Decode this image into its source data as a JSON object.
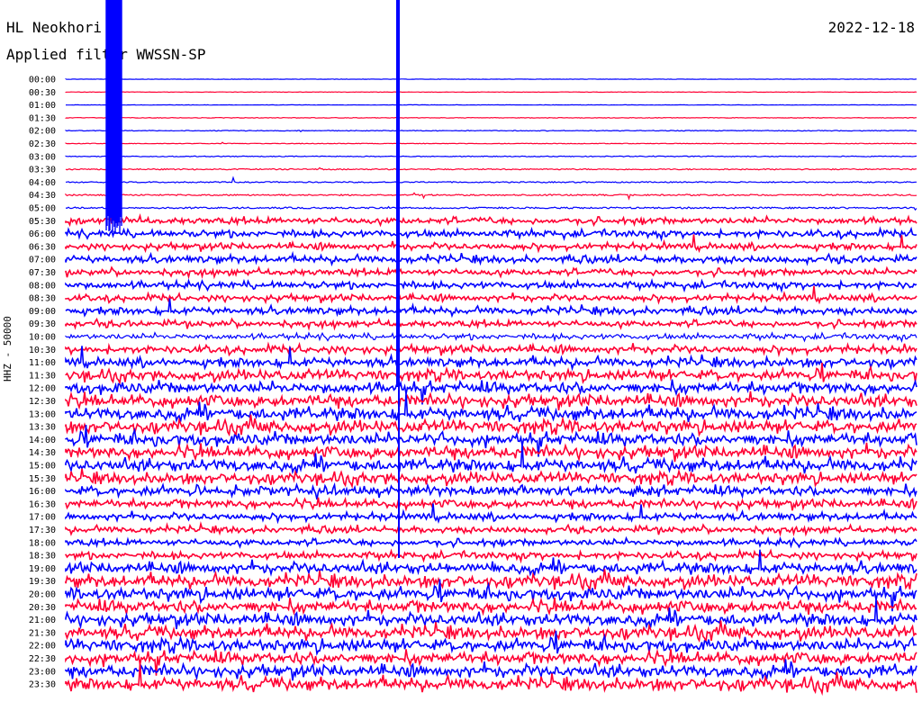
{
  "header": {
    "station": "HL Neokhori",
    "filter": "Applied filter WWSSN-SP",
    "date": "2022-12-18"
  },
  "chart_data": {
    "type": "line",
    "title": "HL Neokhori",
    "subtitle": "Applied filter WWSSN-SP",
    "date": "2022-12-18",
    "ylabel": "HHZ - 50000",
    "xlabel": "",
    "tick_labels": [
      "00:00",
      "00:30",
      "01:00",
      "01:30",
      "02:00",
      "02:30",
      "03:00",
      "03:30",
      "04:00",
      "04:30",
      "05:00",
      "05:30",
      "06:00",
      "06:30",
      "07:00",
      "07:30",
      "08:00",
      "08:30",
      "09:00",
      "09:30",
      "10:00",
      "10:30",
      "11:00",
      "11:30",
      "12:00",
      "12:30",
      "13:00",
      "13:30",
      "14:00",
      "14:30",
      "15:00",
      "15:30",
      "16:00",
      "16:30",
      "17:00",
      "17:30",
      "18:00",
      "18:30",
      "19:00",
      "19:30",
      "20:00",
      "20:30",
      "21:00",
      "21:30",
      "22:00",
      "22:30",
      "23:00",
      "23:30"
    ],
    "series_colors": [
      "#0000ff",
      "#ff0033"
    ],
    "trace_activity": [
      0.08,
      0.1,
      0.08,
      0.12,
      0.15,
      0.13,
      0.18,
      0.25,
      0.25,
      0.3,
      0.35,
      0.55,
      0.6,
      0.55,
      0.6,
      0.55,
      0.6,
      0.55,
      0.6,
      0.55,
      0.5,
      0.65,
      0.75,
      0.85,
      0.95,
      1.0,
      1.0,
      1.0,
      1.0,
      1.0,
      1.0,
      0.9,
      0.8,
      0.7,
      0.6,
      0.55,
      0.55,
      0.6,
      0.9,
      1.0,
      1.0,
      1.0,
      1.0,
      1.0,
      1.0,
      1.0,
      1.0,
      1.0
    ]
  }
}
